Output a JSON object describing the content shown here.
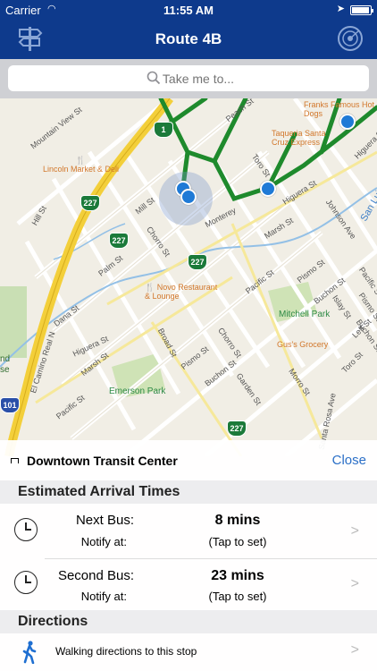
{
  "status": {
    "carrier": "Carrier",
    "time": "11:55 AM"
  },
  "nav": {
    "title": "Route 4B"
  },
  "search": {
    "placeholder": "Take me to..."
  },
  "map": {
    "streets": [
      "Mountain View St",
      "Peach St",
      "Mill St",
      "Hill St",
      "Chorro St",
      "Palm St",
      "Monterey",
      "Toro St",
      "Higuera St",
      "Marsh St",
      "Johnson Ave",
      "Higuera St",
      "El Camino Real N",
      "Dana St",
      "Higuera St",
      "Pacific St",
      "Marsh St",
      "Pismo St",
      "Buchon St",
      "Broad St",
      "Pismo St",
      "Chorro St",
      "Buchon St",
      "Garden St",
      "Morro St",
      "Pacific St",
      "Pismo St",
      "Buchon St",
      "Islay St",
      "Leff St",
      "Toro St",
      "San Luis",
      "Pacific St",
      "Santa Rosa Ave"
    ],
    "pois": [
      "Lincoln Market & Deli",
      "Franks Famous Hot Dogs",
      "Taqueria Santa Cruz Express",
      "Novo Restaurant & Lounge",
      "Gus's Grocery"
    ],
    "parks": [
      "Mitchell Park",
      "Emerson Park"
    ],
    "highways": [
      "1",
      "227",
      "227",
      "227",
      "227",
      "101"
    ],
    "partial": [
      "nd",
      "se"
    ]
  },
  "sheet": {
    "stop_name": "Downtown Transit Center",
    "close": "Close",
    "arrivals_header": "Estimated Arrival Times",
    "next_bus": {
      "label": "Next Bus:",
      "notify": "Notify at:",
      "time": "8 mins",
      "action": "(Tap to set)"
    },
    "second_bus": {
      "label": "Second Bus:",
      "notify": "Notify at:",
      "time": "23 mins",
      "action": "(Tap to set)"
    },
    "directions_header": "Directions",
    "walk": "Walking directions to this stop"
  },
  "colors": {
    "navbar": "#0e3a8c",
    "route": "#1e8a2c",
    "bus": "#1f7ad6",
    "link": "#2b6fc7",
    "highway": "#f3cf3a"
  }
}
